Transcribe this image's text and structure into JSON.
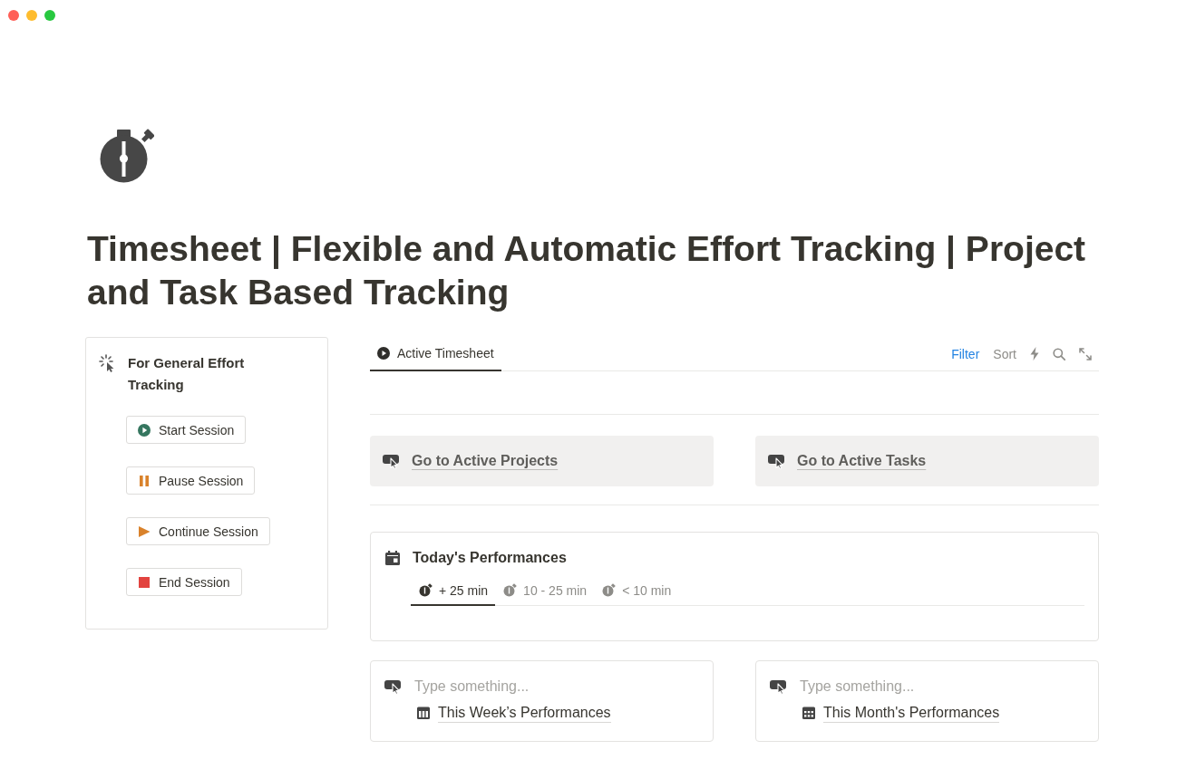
{
  "page": {
    "title": "Timesheet | Flexible and Automatic Effort Tracking | Project and Task Based Tracking"
  },
  "session_panel": {
    "heading": "For General Effort Tracking",
    "buttons": [
      {
        "kind": "start",
        "label": "Start Session"
      },
      {
        "kind": "pause",
        "label": "Pause Session"
      },
      {
        "kind": "continue",
        "label": "Continue Session"
      },
      {
        "kind": "end",
        "label": "End Session"
      }
    ]
  },
  "timesheet_view": {
    "tabs": [
      {
        "label": "Active Timesheet",
        "selected": true
      }
    ],
    "filter": {
      "label": "Filter",
      "active": true
    },
    "sort": {
      "label": "Sort",
      "active": false
    }
  },
  "callouts": [
    {
      "link": "Go to Active Projects"
    },
    {
      "link": "Go to Active Tasks"
    }
  ],
  "performance_card": {
    "title": "Today's Performances",
    "tabs": [
      {
        "label": "+ 25 min",
        "selected": true
      },
      {
        "label": "10 - 25 min",
        "selected": false
      },
      {
        "label": "< 10 min",
        "selected": false
      }
    ]
  },
  "summary_cards": [
    {
      "placeholder": "Type something...",
      "kind": "week",
      "link": "This Week’s Performances"
    },
    {
      "placeholder": "Type something...",
      "kind": "month",
      "link": "This Month's Performances"
    }
  ]
}
